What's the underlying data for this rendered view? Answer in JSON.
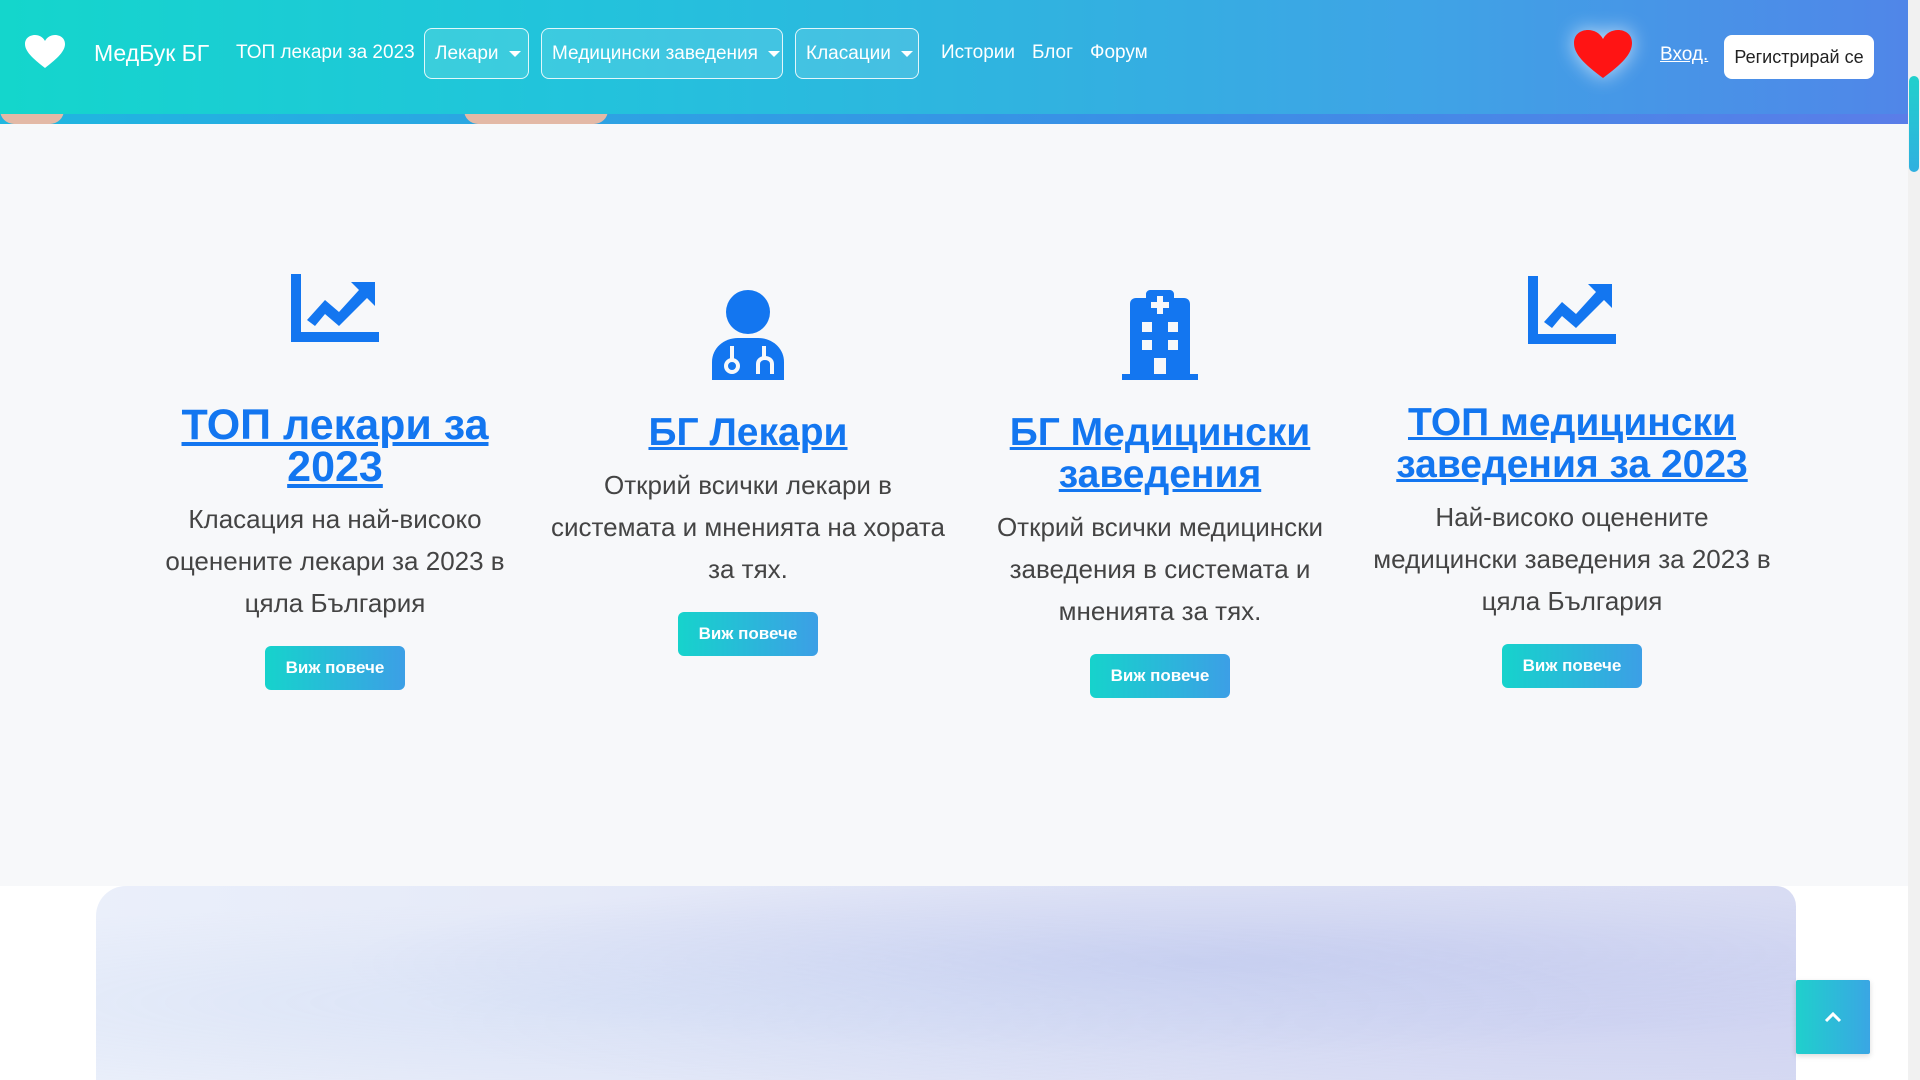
{
  "colors": {
    "accent_blue": "#1376f0",
    "nav_gradient_start": "#14d6cc",
    "nav_gradient_end": "#5086e8",
    "heart_red": "#ff1414"
  },
  "navbar": {
    "brand": "МедБук БГ",
    "top_doctors_link": "ТОП лекари за 2023",
    "dropdowns": [
      {
        "label": "Лекари"
      },
      {
        "label": "Медицински заведения"
      },
      {
        "label": "Класации"
      }
    ],
    "links": [
      {
        "label": "Истории"
      },
      {
        "label": "Блог"
      },
      {
        "label": "Форум"
      }
    ],
    "login": "Вход.",
    "register": "Регистрирай се"
  },
  "features": [
    {
      "icon": "chart-line-icon",
      "title": "ТОП лекари за 2023",
      "description": "Класация на най-високо оценените лекари за 2023 в цяла България",
      "button": "Виж повече"
    },
    {
      "icon": "doctor-icon",
      "title": "БГ Лекари",
      "description": "Открий всички лекари в системата и мненията на хората за тях.",
      "button": "Виж повече"
    },
    {
      "icon": "hospital-icon",
      "title": "БГ Медицински заведения",
      "description": "Открий всички медицински заведения в системата и мненията за тях.",
      "button": "Виж повече"
    },
    {
      "icon": "chart-line-icon",
      "title": "ТОП медицински заведения за 2023",
      "description": "Най-високо оценените медицински заведения за 2023 в цяла България",
      "button": "Виж повече"
    }
  ],
  "back_to_top": {
    "icon": "chevron-up-icon"
  }
}
